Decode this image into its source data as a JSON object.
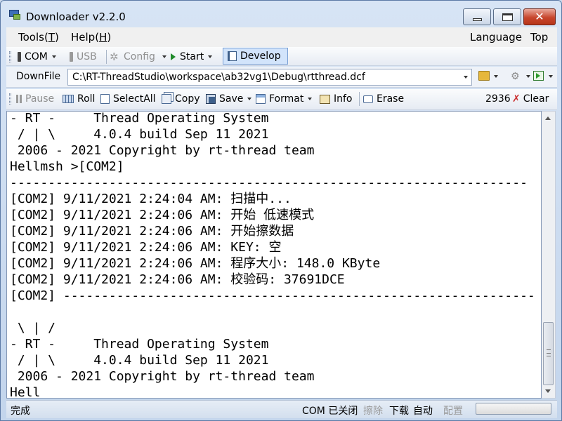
{
  "window": {
    "title": "Downloader v2.2.0",
    "close_glyph": "✕"
  },
  "menu": {
    "tools": "Tools",
    "tools_key": "T",
    "help": "Help",
    "help_key": "H",
    "language": "Language",
    "top": "Top"
  },
  "toolbar1": {
    "com": "COM",
    "usb": "USB",
    "config": "Config",
    "config_icon": "✲",
    "start": "Start",
    "develop": "Develop"
  },
  "toolbar2": {
    "downfile_label": "DownFile",
    "path": "C:\\RT-ThreadStudio\\workspace\\ab32vg1\\Debug\\rtthread.dcf",
    "tool_icon": "⚙"
  },
  "toolbar3": {
    "pause": "Pause",
    "roll": "Roll",
    "select_all": "SelectAll",
    "copy": "Copy",
    "save": "Save",
    "format": "Format",
    "info": "Info",
    "erase": "Erase",
    "count": "2936",
    "clear": "Clear",
    "clear_icon": "✗"
  },
  "terminal": {
    "lines": [
      "- RT -     Thread Operating System",
      " / | \\     4.0.4 build Sep 11 2021",
      " 2006 - 2021 Copyright by rt-thread team",
      "Hellmsh >[COM2]",
      "--------------------------------------------------------------------",
      "[COM2] 9/11/2021 2:24:04 AM: 扫描中...",
      "[COM2] 9/11/2021 2:24:06 AM: 开始 低速模式",
      "[COM2] 9/11/2021 2:24:06 AM: 开始擦数据",
      "[COM2] 9/11/2021 2:24:06 AM: KEY: 空",
      "[COM2] 9/11/2021 2:24:06 AM: 程序大小: 148.0 KByte",
      "[COM2] 9/11/2021 2:24:06 AM: 校验码: 37691DCE",
      "[COM2] --------------------------------------------------------------",
      "",
      " \\ | /",
      "- RT -     Thread Operating System",
      " / | \\     4.0.4 build Sep 11 2021",
      " 2006 - 2021 Copyright by rt-thread team",
      "Hell"
    ]
  },
  "status": {
    "left": "完成",
    "com_closed": "COM 已关闭",
    "erase": "擦除",
    "download": "下载",
    "auto": "自动",
    "config": "配置",
    "progress": 0
  }
}
